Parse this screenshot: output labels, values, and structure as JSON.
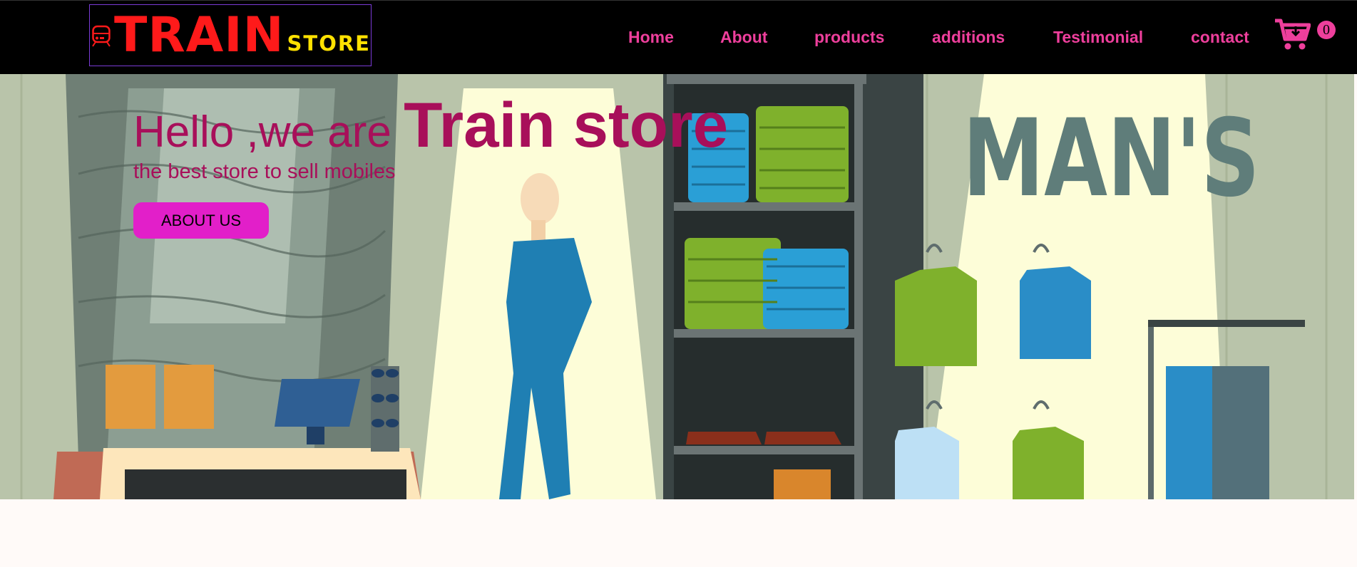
{
  "brand": {
    "train": "TRAIN",
    "store": "STORE",
    "icon": "train-icon"
  },
  "nav": {
    "items": [
      {
        "label": "Home"
      },
      {
        "label": "About"
      },
      {
        "label": "products"
      },
      {
        "label": "additions"
      },
      {
        "label": "Testimonial"
      },
      {
        "label": "contact"
      }
    ],
    "cart": {
      "icon": "cart-download-icon",
      "count": "0"
    }
  },
  "hero": {
    "title_small": "Hello ,we are ",
    "title_big": "Train store",
    "subtitle": "the best store to sell mobiles",
    "button": "ABOUT US",
    "sign": "MAN'S"
  },
  "colors": {
    "nav_background": "#000000",
    "nav_link": "#ee3f9c",
    "brand_red": "#ff1a1a",
    "brand_yellow": "#ffe100",
    "hero_text": "#a80f5a",
    "button": "#e21fc9"
  }
}
